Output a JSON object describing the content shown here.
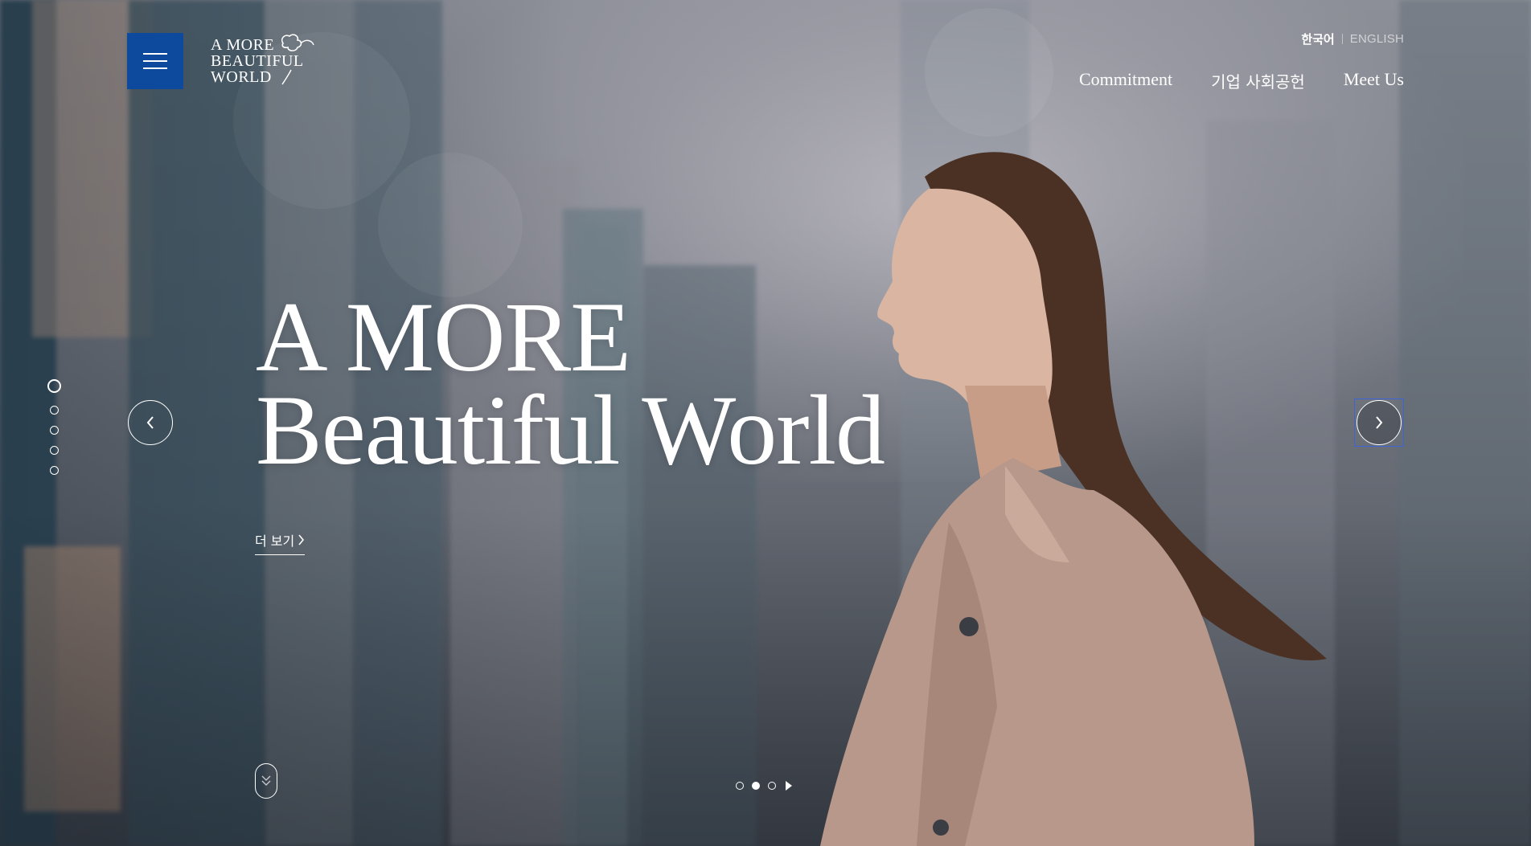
{
  "header": {
    "logo_lines": [
      "A MORE",
      "BEAUTIFUL",
      "WORLD"
    ],
    "languages": {
      "korean": "한국어",
      "english": "ENGLISH",
      "active": "korean"
    },
    "nav": [
      {
        "label": "Commitment"
      },
      {
        "label": "기업 사회공헌"
      },
      {
        "label": "Meet Us"
      }
    ],
    "menu_icon": "hamburger-icon"
  },
  "hero": {
    "title_line1": "A MORE",
    "title_line2": "Beautiful World",
    "more_label": "더 보기",
    "more_icon": "chevron-right-icon"
  },
  "section_dots": {
    "count": 5,
    "active_index": 0
  },
  "slider": {
    "prev_icon": "chevron-left-icon",
    "next_icon": "chevron-right-icon",
    "slide_count": 3,
    "active_index": 1,
    "play_icon": "play-icon"
  },
  "scroll": {
    "icon": "double-chevron-down-icon"
  },
  "colors": {
    "menu_button": "#0d4a9e",
    "focus_outline": "#3d64d8",
    "text": "#ffffff"
  }
}
